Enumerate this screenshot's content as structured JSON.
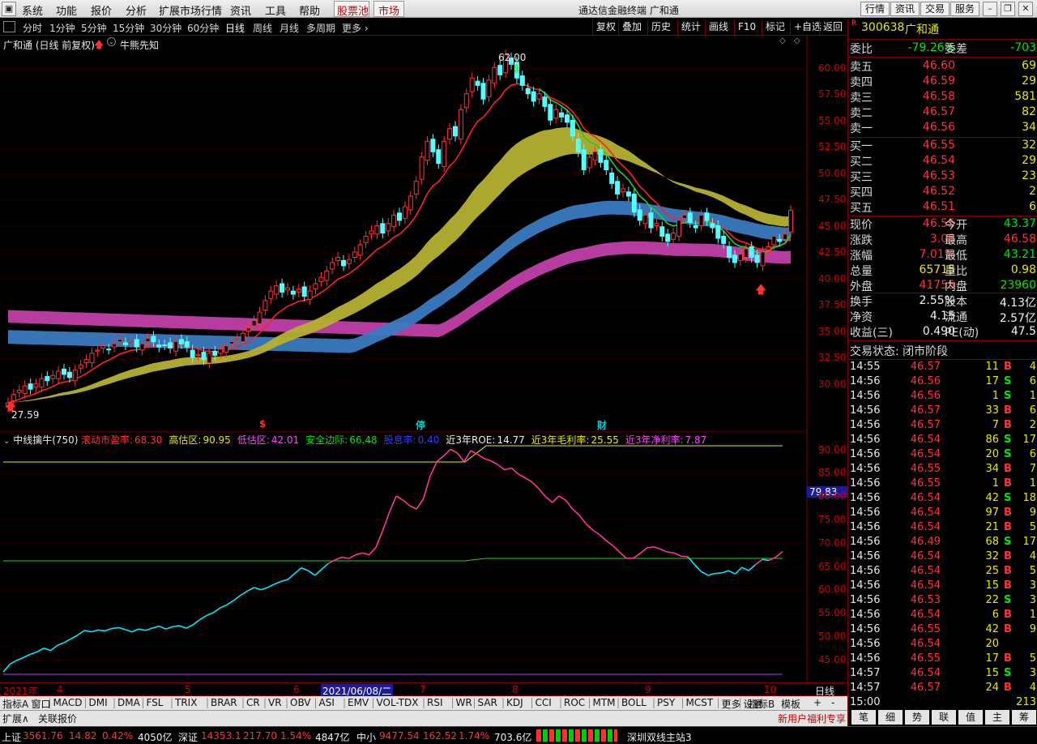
{
  "menu": {
    "items": [
      "系统",
      "功能",
      "报价",
      "分析",
      "扩展市场行情",
      "资讯",
      "工具",
      "帮助"
    ],
    "stock_pool": "股票池",
    "market": "市场",
    "app_title": "通达信金融终端",
    "stock_title": "广和通",
    "right_buttons": [
      "行情",
      "资讯",
      "交易",
      "服务"
    ]
  },
  "period": {
    "items": [
      "分时",
      "1分钟",
      "5分钟",
      "15分钟",
      "30分钟",
      "60分钟",
      "日线",
      "周线",
      "月线",
      "多周期",
      "更多"
    ],
    "selected": "日线",
    "tools": [
      "复权",
      "叠加",
      "历史",
      "统计",
      "画线",
      "F10",
      "标记",
      "+自选",
      "返回"
    ]
  },
  "chart": {
    "header": "广和通 (日线 前复权)",
    "indicator_name": "牛熊先知",
    "high_label": "62.00",
    "low_label": "27.59",
    "price_ticks": [
      "60.00",
      "57.50",
      "55.00",
      "52.50",
      "50.00",
      "47.50",
      "45.00",
      "42.50",
      "40.00",
      "37.50",
      "35.00",
      "32.50",
      "30.00"
    ],
    "event_markers": [
      "$",
      "停",
      "财"
    ],
    "colors": {
      "up": "#ff3232",
      "down": "#54ffff",
      "ma_fast": "#ff2020",
      "ma_green": "#22d022",
      "band_yellow": "#b5b030",
      "band_blue": "#3a7ac0",
      "band_magenta": "#c040a8"
    }
  },
  "chart_data": [
    {
      "type": "candlestick",
      "title": "广和通 (日线 前复权)",
      "ylim": [
        27.0,
        62.5
      ],
      "x_labels": [
        "2021年",
        "4",
        "5",
        "6",
        "2021/06/08/二",
        "7",
        "8",
        "9",
        "10"
      ],
      "annotations": {
        "high": 62.0,
        "low": 27.59,
        "last_close": 46.55
      },
      "close": [
        28.3,
        29.1,
        29.5,
        29.9,
        29.6,
        30.1,
        30.6,
        30.4,
        30.9,
        31.3,
        31.0,
        30.7,
        31.4,
        31.9,
        32.4,
        33.0,
        33.3,
        33.7,
        33.4,
        33.9,
        34.3,
        33.8,
        34.1,
        33.6,
        33.9,
        34.4,
        34.1,
        33.6,
        33.8,
        33.5,
        34.1,
        33.9,
        33.6,
        32.6,
        32.9,
        32.4,
        33.0,
        32.8,
        33.4,
        33.7,
        34.1,
        34.4,
        34.9,
        35.4,
        36.1,
        36.9,
        38.0,
        38.9,
        39.4,
        38.8,
        39.2,
        38.6,
        39.1,
        38.4,
        38.9,
        39.6,
        40.2,
        40.8,
        41.6,
        42.1,
        41.3,
        41.9,
        42.6,
        43.3,
        44.1,
        44.6,
        45.1,
        44.4,
        45.3,
        46.1,
        45.6,
        46.9,
        47.9,
        49.3,
        51.6,
        53.1,
        52.1,
        51.0,
        53.1,
        54.3,
        53.6,
        56.1,
        57.6,
        59.1,
        58.4,
        57.1,
        58.9,
        60.1,
        59.4,
        61.3,
        60.4,
        59.1,
        58.4,
        57.6,
        56.9,
        57.6,
        56.4,
        55.1,
        56.1,
        55.4,
        54.9,
        53.6,
        52.1,
        50.4,
        51.6,
        52.1,
        51.1,
        50.4,
        49.1,
        48.1,
        48.6,
        47.9,
        46.4,
        45.6,
        46.1,
        44.9,
        45.3,
        44.1,
        43.6,
        44.4,
        45.6,
        46.1,
        45.4,
        44.9,
        46.1,
        45.6,
        44.9,
        43.9,
        43.4,
        42.1,
        41.6,
        42.4,
        42.9,
        42.1,
        41.6,
        42.6,
        43.1,
        44.1,
        43.6,
        44.3,
        46.55
      ]
    },
    {
      "type": "line",
      "title": "中线擒牛(750)",
      "ylim": [
        42.0,
        92.0
      ],
      "metrics": {
        "滚动市盈率": 68.3,
        "高估区": 90.95,
        "低估区": 42.01,
        "安全边际": 66.48,
        "股息率": 0.4,
        "近3年ROE": 14.77,
        "近3年毛利率": 25.55,
        "近3年净利率": 7.87
      },
      "current": 79.83,
      "y_ticks": [
        "90.00",
        "85.00",
        "80.00",
        "75.00",
        "70.00",
        "65.00",
        "60.00",
        "55.00",
        "50.00",
        "45.00"
      ],
      "values": [
        42.5,
        44.2,
        45.0,
        45.6,
        46.3,
        46.8,
        47.6,
        47.1,
        48.2,
        48.8,
        49.6,
        50.4,
        51.4,
        51.1,
        51.5,
        51.3,
        51.8,
        52.0,
        51.6,
        51.1,
        51.7,
        51.4,
        51.9,
        52.3,
        51.7,
        52.2,
        52.4,
        51.9,
        52.6,
        53.7,
        54.6,
        55.2,
        56.2,
        56.9,
        57.8,
        58.9,
        59.8,
        60.6,
        60.1,
        60.6,
        61.3,
        61.9,
        62.3,
        63.6,
        64.8,
        64.2,
        63.2,
        64.5,
        65.8,
        66.5,
        67.1,
        66.8,
        67.6,
        68.0,
        67.6,
        69.2,
        72.8,
        76.8,
        80.2,
        79.3,
        78.1,
        77.4,
        79.6,
        84.5,
        87.6,
        88.8,
        90.2,
        89.4,
        87.6,
        89.9,
        89.1,
        88.2,
        87.7,
        86.9,
        85.8,
        86.2,
        84.9,
        84.1,
        83.2,
        81.8,
        80.1,
        78.8,
        80.2,
        79.3,
        77.4,
        76.1,
        74.2,
        72.9,
        71.9,
        70.6,
        69.5,
        68.1,
        66.8,
        66.9,
        67.9,
        69.1,
        69.3,
        68.8,
        68.2,
        68.0,
        67.3,
        67.2,
        65.5,
        64.0,
        63.2,
        63.6,
        63.7,
        64.2,
        63.5,
        64.9,
        64.2,
        65.5,
        66.6,
        66.4,
        67.1,
        68.3
      ],
      "lines": {
        "高估区": 90.95,
        "安全边际": 66.48,
        "低估区": 42.01
      }
    }
  ],
  "subchart": {
    "header": "中线擒牛(750)",
    "items": [
      {
        "label": "滚动市盈率:",
        "value": "68.30",
        "color": "#ff3333"
      },
      {
        "label": "高估区:",
        "value": "90.95",
        "color": "#e6e600"
      },
      {
        "label": "低估区:",
        "value": "42.01",
        "color": "#ff44ff"
      },
      {
        "label": "安全边际:",
        "value": "66.48",
        "color": "#00e600"
      },
      {
        "label": "股息率:",
        "value": "0.40",
        "color": "#3a3aff"
      },
      {
        "label": "近3年ROE:",
        "value": "14.77",
        "color": "#f0f0f0"
      },
      {
        "label": "近3年毛利率:",
        "value": "25.55",
        "color": "#e6e600"
      },
      {
        "label": "近3年净利率:",
        "value": "7.87",
        "color": "#ff44ff"
      }
    ],
    "current_label": "79.83",
    "y_ticks": [
      "90.00",
      "85.00",
      "80.00",
      "75.00",
      "70.00",
      "65.00",
      "60.00",
      "55.00",
      "50.00",
      "45.00"
    ]
  },
  "xaxis": {
    "labels": [
      "2021年",
      "4",
      "5",
      "6",
      "2021/06/08/二",
      "7",
      "8",
      "9",
      "10"
    ],
    "period_label": "日线"
  },
  "indicators": {
    "items": [
      "指标A",
      "窗口",
      "MACD",
      "DMI",
      "DMA",
      "FSL",
      "TRIX",
      "BRAR",
      "CR",
      "VR",
      "OBV",
      "ASI",
      "EMV",
      "VOL-TDX",
      "RSI",
      "WR",
      "SAR",
      "KDJ",
      "CCI",
      "ROC",
      "MTM",
      "BOLL",
      "PSY",
      "MCST",
      "更多",
      "设置"
    ],
    "right": [
      "指标B",
      "模板",
      "+",
      "-"
    ],
    "ext": [
      "扩展∧",
      "关联报价"
    ],
    "promo": "新用户福利专享"
  },
  "quote": {
    "code": "300638",
    "name": "广和通",
    "webi_label": "委比",
    "webi": "-79.26%",
    "weicha_label": "委差",
    "weicha": "-703",
    "asks": [
      {
        "label": "卖五",
        "price": "46.60",
        "vol": "69"
      },
      {
        "label": "卖四",
        "price": "46.59",
        "vol": "29"
      },
      {
        "label": "卖三",
        "price": "46.58",
        "vol": "581"
      },
      {
        "label": "卖二",
        "price": "46.57",
        "vol": "82"
      },
      {
        "label": "卖一",
        "price": "46.56",
        "vol": "34"
      }
    ],
    "bids": [
      {
        "label": "买一",
        "price": "46.55",
        "vol": "32"
      },
      {
        "label": "买二",
        "price": "46.54",
        "vol": "29"
      },
      {
        "label": "买三",
        "price": "46.53",
        "vol": "23"
      },
      {
        "label": "买四",
        "price": "46.52",
        "vol": "2"
      },
      {
        "label": "买五",
        "price": "46.51",
        "vol": "6"
      }
    ],
    "stats": [
      {
        "l1": "现价",
        "v1": "46.55",
        "c1": "red",
        "l2": "今开",
        "v2": "43.37",
        "c2": "grn"
      },
      {
        "l1": "涨跌",
        "v1": "3.05",
        "c1": "red",
        "l2": "最高",
        "v2": "46.58",
        "c2": "red"
      },
      {
        "l1": "涨幅",
        "v1": "7.01%",
        "c1": "red",
        "l2": "最低",
        "v2": "43.21",
        "c2": "grn"
      },
      {
        "l1": "总量",
        "v1": "65715",
        "c1": "yel",
        "l2": "量比",
        "v2": "0.98",
        "c2": "yel"
      },
      {
        "l1": "外盘",
        "v1": "41755",
        "c1": "red",
        "l2": "内盘",
        "v2": "23960",
        "c2": "grn"
      }
    ],
    "fin": [
      {
        "l1": "换手",
        "v1": "2.55%",
        "l2": "股本",
        "v2": "4.13亿"
      },
      {
        "l1": "净资",
        "v1": "4.15",
        "l2": "流通",
        "v2": "2.57亿"
      },
      {
        "l1": "收益(三)",
        "v1": "0.490",
        "l2": "PE(动)",
        "v2": "47.5"
      }
    ],
    "status": "交易状态: 闭市阶段"
  },
  "ticks": [
    {
      "t": "14:55",
      "p": "46.57",
      "v": "11",
      "bs": "B",
      "n": "4"
    },
    {
      "t": "14:56",
      "p": "46.56",
      "v": "17",
      "bs": "S",
      "n": "6"
    },
    {
      "t": "14:56",
      "p": "46.56",
      "v": "1",
      "bs": "S",
      "n": "1"
    },
    {
      "t": "14:56",
      "p": "46.57",
      "v": "33",
      "bs": "B",
      "n": "6"
    },
    {
      "t": "14:56",
      "p": "46.57",
      "v": "7",
      "bs": "B",
      "n": "2"
    },
    {
      "t": "14:56",
      "p": "46.54",
      "v": "86",
      "bs": "S",
      "n": "17"
    },
    {
      "t": "14:56",
      "p": "46.54",
      "v": "20",
      "bs": "S",
      "n": "6"
    },
    {
      "t": "14:56",
      "p": "46.55",
      "v": "34",
      "bs": "B",
      "n": "7"
    },
    {
      "t": "14:56",
      "p": "46.55",
      "v": "1",
      "bs": "B",
      "n": "1"
    },
    {
      "t": "14:56",
      "p": "46.54",
      "v": "42",
      "bs": "S",
      "n": "18"
    },
    {
      "t": "14:56",
      "p": "46.54",
      "v": "97",
      "bs": "B",
      "n": "9"
    },
    {
      "t": "14:56",
      "p": "46.54",
      "v": "21",
      "bs": "B",
      "n": "5"
    },
    {
      "t": "14:56",
      "p": "46.49",
      "v": "68",
      "bs": "S",
      "n": "17"
    },
    {
      "t": "14:56",
      "p": "46.54",
      "v": "32",
      "bs": "B",
      "n": "4"
    },
    {
      "t": "14:56",
      "p": "46.54",
      "v": "25",
      "bs": "B",
      "n": "5"
    },
    {
      "t": "14:56",
      "p": "46.54",
      "v": "15",
      "bs": "B",
      "n": "3"
    },
    {
      "t": "14:56",
      "p": "46.53",
      "v": "22",
      "bs": "S",
      "n": "3"
    },
    {
      "t": "14:56",
      "p": "46.54",
      "v": "6",
      "bs": "B",
      "n": "1"
    },
    {
      "t": "14:56",
      "p": "46.55",
      "v": "42",
      "bs": "B",
      "n": "9"
    },
    {
      "t": "14:56",
      "p": "46.54",
      "v": "20",
      "bs": "",
      "n": ""
    },
    {
      "t": "14:56",
      "p": "46.55",
      "v": "17",
      "bs": "B",
      "n": "5"
    },
    {
      "t": "14:57",
      "p": "46.54",
      "v": "15",
      "bs": "S",
      "n": "3"
    },
    {
      "t": "14:57",
      "p": "46.57",
      "v": "24",
      "bs": "B",
      "n": "4"
    },
    {
      "t": "15:00",
      "p": "",
      "v": "",
      "bs": "",
      "n": "213"
    }
  ],
  "sidetabs": [
    "笔",
    "细",
    "势",
    "联",
    "值",
    "主",
    "筹"
  ],
  "statusbar": {
    "sh_label": "上证",
    "sh_idx": "3561.76",
    "sh_chg": "14.82",
    "sh_pct": "0.42%",
    "sh_amt": "4050亿",
    "sz_label": "深证",
    "sz_idx": "14353.1",
    "sz_chg": "217.70",
    "sz_pct": "1.54%",
    "sz_amt": "4847亿",
    "zx_label": "中小",
    "zx_idx": "9477.54",
    "zx_chg": "162.52",
    "zx_pct": "1.74%",
    "zx_amt": "703.6亿",
    "server": "深圳双线主站3"
  }
}
